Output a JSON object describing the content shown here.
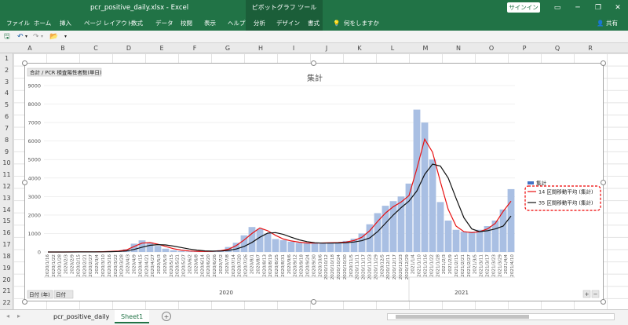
{
  "window": {
    "title": "pcr_positive_daily.xlsx  -  Excel",
    "context_tool": "ピボットグラフ ツール",
    "signin": "サインイン",
    "share": "共有",
    "tell_me": "何をしますか"
  },
  "ribbon_tabs": [
    "ファイル",
    "ホーム",
    "挿入",
    "ページ レイアウト",
    "数式",
    "データ",
    "校閲",
    "表示",
    "ヘルプ",
    "分析",
    "デザイン",
    "書式"
  ],
  "columns": [
    "A",
    "B",
    "C",
    "D",
    "E",
    "F",
    "G",
    "H",
    "I",
    "J",
    "K",
    "L",
    "M",
    "N",
    "O",
    "P",
    "Q",
    "R"
  ],
  "rows": [
    "1",
    "2",
    "3",
    "4",
    "5",
    "6",
    "7",
    "8",
    "9",
    "10",
    "11",
    "12",
    "13",
    "14",
    "15",
    "16",
    "17",
    "18",
    "19",
    "20",
    "21",
    "22"
  ],
  "chart": {
    "field_button": "合計 / PCR 検査陽性者数(単日)",
    "filter_year": "日付 (年)",
    "filter_date": "日付",
    "zoom_buttons": [
      "+",
      "−"
    ]
  },
  "chart_data": {
    "type": "bar",
    "title": "集計",
    "ylim": [
      0,
      9000
    ],
    "yticks": [
      0,
      1000,
      2000,
      3000,
      4000,
      5000,
      6000,
      7000,
      8000,
      9000
    ],
    "x_tick_labels": [
      "2020/1/16",
      "2020/1/22",
      "2020/1/28",
      "2020/2/3",
      "2020/2/9",
      "2020/2/15",
      "2020/2/21",
      "2020/2/27",
      "2020/3/4",
      "2020/3/10",
      "2020/3/16",
      "2020/3/22",
      "2020/3/28",
      "2020/4/3",
      "2020/4/9",
      "2020/4/15",
      "2020/4/21",
      "2020/4/27",
      "2020/5/3",
      "2020/5/9",
      "2020/5/15",
      "2020/5/21",
      "2020/5/27",
      "2020/6/2",
      "2020/6/8",
      "2020/6/14",
      "2020/6/20",
      "2020/6/26",
      "2020/7/2",
      "2020/7/8",
      "2020/7/14",
      "2020/7/20",
      "2020/7/26",
      "2020/8/1",
      "2020/8/7",
      "2020/8/13",
      "2020/8/19",
      "2020/8/25",
      "2020/8/31",
      "2020/9/6",
      "2020/9/12",
      "2020/9/18",
      "2020/9/24",
      "2020/9/30",
      "2020/10/6",
      "2020/10/12",
      "2020/10/18",
      "2020/10/24",
      "2020/10/30",
      "2020/11/5",
      "2020/11/11",
      "2020/11/17",
      "2020/11/23",
      "2020/11/29",
      "2020/12/5",
      "2020/12/11",
      "2020/12/17",
      "2020/12/23",
      "2020/12/29",
      "2021/1/4",
      "2021/1/10",
      "2021/1/16",
      "2021/1/22",
      "2021/1/28",
      "2021/2/3",
      "2021/2/9",
      "2021/2/15",
      "2021/2/21",
      "2021/2/27",
      "2021/3/5",
      "2021/3/11",
      "2021/3/17",
      "2021/3/23",
      "2021/3/29",
      "2021/4/4",
      "2021/4/10"
    ],
    "year_labels": [
      "2020",
      "2021"
    ],
    "legend_position": "right",
    "series": [
      {
        "name": "集計",
        "kind": "bar",
        "color": "#a9bfe3",
        "values": [
          1,
          3,
          3,
          4,
          5,
          10,
          15,
          25,
          45,
          60,
          150,
          450,
          630,
          520,
          330,
          180,
          95,
          50,
          30,
          30,
          40,
          55,
          100,
          270,
          500,
          900,
          1350,
          1250,
          1000,
          700,
          640,
          560,
          500,
          500,
          500,
          500,
          520,
          500,
          600,
          720,
          1000,
          1500,
          2100,
          2500,
          2750,
          3000,
          3700,
          7700,
          7000,
          5000,
          2700,
          1700,
          1200,
          1100,
          1100,
          1200,
          1400,
          1700,
          2300,
          3400
        ]
      },
      {
        "name": "14 区間移動平均 (集計)",
        "kind": "line",
        "color": "#e81010",
        "values": [
          0,
          1,
          2,
          3,
          4,
          6,
          10,
          18,
          35,
          55,
          110,
          300,
          480,
          510,
          420,
          300,
          180,
          100,
          55,
          35,
          30,
          40,
          70,
          150,
          350,
          650,
          1000,
          1300,
          1150,
          900,
          700,
          600,
          530,
          490,
          480,
          490,
          500,
          510,
          540,
          620,
          800,
          1150,
          1650,
          2100,
          2450,
          2700,
          3050,
          4500,
          6100,
          5400,
          3800,
          2300,
          1400,
          1100,
          1050,
          1100,
          1250,
          1550,
          2200,
          2750
        ]
      },
      {
        "name": "35 区間移動平均 (集計)",
        "kind": "line",
        "color": "#111111",
        "values": [
          0,
          0,
          1,
          2,
          3,
          4,
          6,
          10,
          18,
          30,
          55,
          140,
          260,
          360,
          400,
          380,
          320,
          240,
          160,
          100,
          60,
          45,
          50,
          85,
          160,
          300,
          520,
          800,
          1020,
          1050,
          950,
          800,
          660,
          560,
          500,
          480,
          480,
          490,
          500,
          540,
          610,
          760,
          1100,
          1550,
          2000,
          2400,
          2750,
          3300,
          4200,
          4750,
          4650,
          4000,
          2900,
          1850,
          1250,
          1100,
          1150,
          1250,
          1400,
          1950
        ]
      }
    ]
  }
}
